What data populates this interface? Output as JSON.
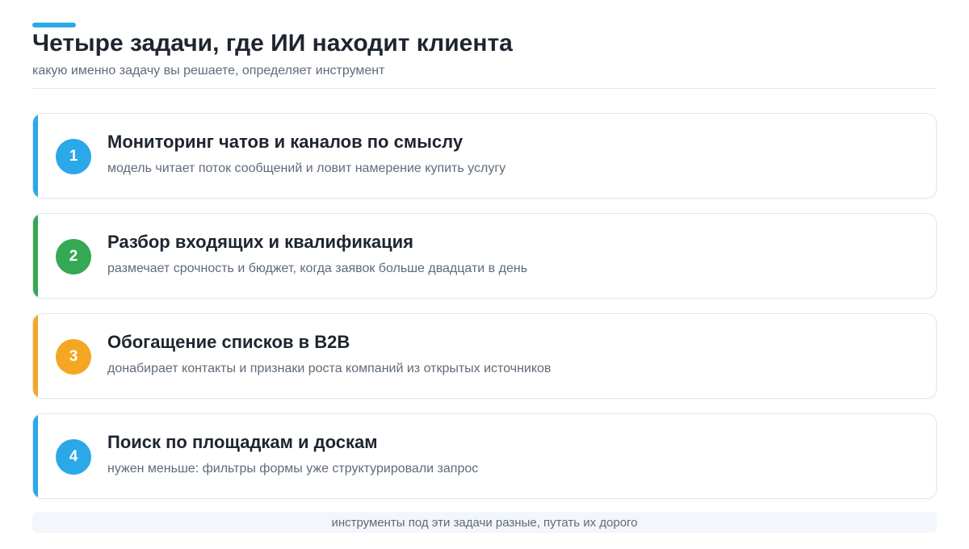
{
  "header": {
    "title": "Четыре задачи, где ИИ находит клиента",
    "subtitle": "какую именно задачу вы решаете, определяет инструмент",
    "accent_color": "#2ba8e8"
  },
  "tasks": [
    {
      "number": "1",
      "title": "Мониторинг чатов и каналов по смыслу",
      "description": "модель читает поток сообщений и ловит намерение купить услугу",
      "color": "#2ba8e8"
    },
    {
      "number": "2",
      "title": "Разбор входящих и квалификация",
      "description": "размечает срочность и бюджет, когда заявок больше двадцати в день",
      "color": "#34a853"
    },
    {
      "number": "3",
      "title": "Обогащение списков в B2B",
      "description": "донабирает контакты и признаки роста компаний из открытых источников",
      "color": "#f5a623"
    },
    {
      "number": "4",
      "title": "Поиск по площадкам и доскам",
      "description": "нужен меньше: фильтры формы уже структурировали запрос",
      "color": "#2ba8e8"
    }
  ],
  "footer": {
    "note": "инструменты под эти задачи разные, путать их дорого"
  }
}
